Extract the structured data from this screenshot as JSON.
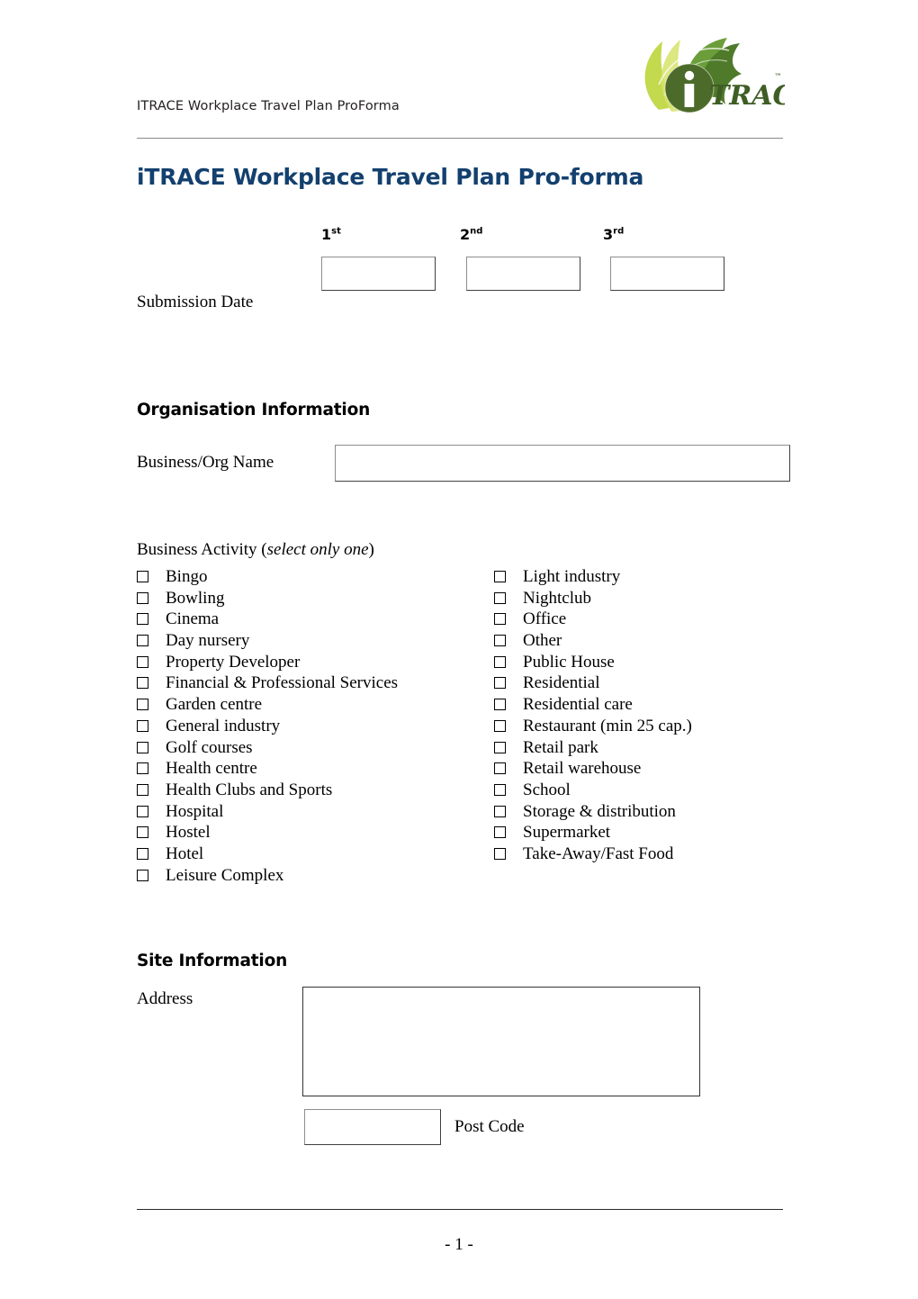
{
  "header": {
    "running_head": "ITRACE Workplace Travel Plan ProForma",
    "logo_wordmark": "TRACE",
    "logo_letter": "i",
    "logo_tm": "™"
  },
  "title": "iTRACE Workplace Travel Plan Pro-forma",
  "submission": {
    "label": "Submission Date",
    "ordinals": [
      {
        "number": "1",
        "suffix": "st",
        "value": ""
      },
      {
        "number": "2",
        "suffix": "nd",
        "value": ""
      },
      {
        "number": "3",
        "suffix": "rd",
        "value": ""
      }
    ]
  },
  "organisation": {
    "heading": "Organisation Information",
    "name_label": "Business/Org Name",
    "name_value": ""
  },
  "activity": {
    "label_main": "Business Activity (",
    "label_italic": "select only one",
    "label_close": ")",
    "left_column": [
      "Bingo",
      "Bowling",
      "Cinema",
      "Day nursery",
      "Property Developer",
      "Financial & Professional Services",
      "Garden centre",
      "General industry",
      "Golf courses",
      "Health centre",
      "Health Clubs and Sports",
      "Hospital",
      "Hostel",
      "Hotel",
      "Leisure Complex"
    ],
    "right_column": [
      "Light industry",
      "Nightclub",
      "Office",
      "Other",
      "Public House",
      "Residential",
      "Residential care",
      "Restaurant (min 25 cap.)",
      "Retail park",
      "Retail warehouse",
      "School",
      "Storage & distribution",
      "Supermarket",
      "Take-Away/Fast Food"
    ]
  },
  "site": {
    "heading": "Site Information",
    "address_label": "Address",
    "address_value": "",
    "postcode_label": "Post Code",
    "postcode_value": ""
  },
  "footer": {
    "page_number": "- 1 -"
  },
  "colors": {
    "title_blue": "#13406e",
    "rule_grey": "#888a8c",
    "logo_leaf_light": "#c3d94e",
    "logo_leaf_mid": "#7aa93c",
    "logo_circle_dark": "#4c6b2a",
    "logo_text_dark": "#3f5e25"
  }
}
